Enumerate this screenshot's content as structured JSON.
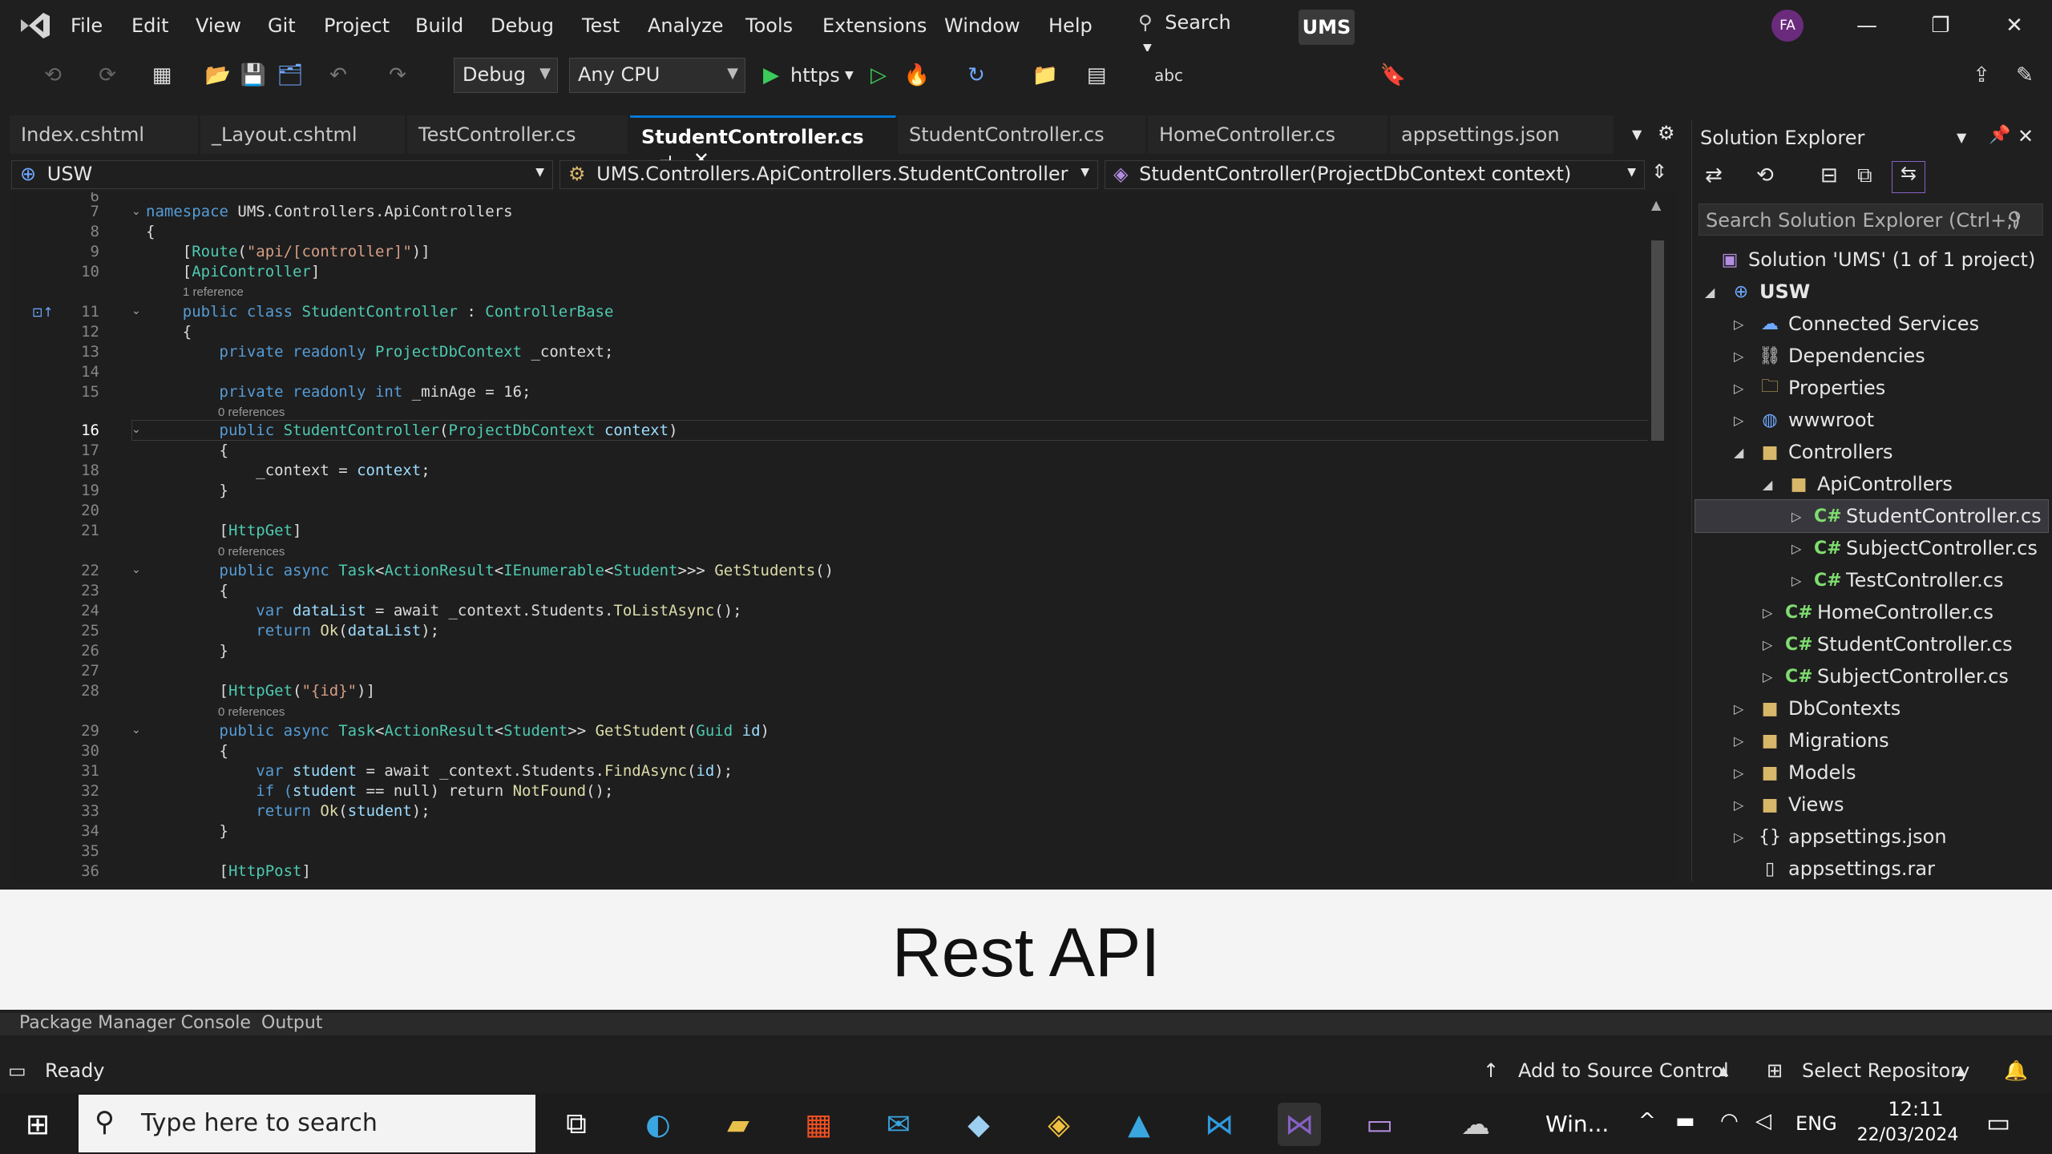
{
  "title_bar": {
    "menus": [
      "File",
      "Edit",
      "View",
      "Git",
      "Project",
      "Build",
      "Debug",
      "Test",
      "Analyze",
      "Tools",
      "Extensions",
      "Window",
      "Help"
    ],
    "search_label": "Search",
    "solution_name": "UMS",
    "avatar_initials": "FA",
    "minimize": "—",
    "restore": "❐",
    "close": "✕"
  },
  "toolbar": {
    "config": "Debug",
    "platform": "Any CPU",
    "run_profile": "https"
  },
  "tabs": [
    {
      "label": "Index.cshtml"
    },
    {
      "label": "_Layout.cshtml"
    },
    {
      "label": "TestController.cs"
    },
    {
      "label": "StudentController.cs"
    },
    {
      "label": "StudentController.cs"
    },
    {
      "label": "HomeController.cs"
    },
    {
      "label": "appsettings.json"
    }
  ],
  "navbar": {
    "project": "USW",
    "type": "UMS.Controllers.ApiControllers.StudentController",
    "member": "StudentController(ProjectDbContext context)"
  },
  "editor": {
    "line_numbers": [
      "6",
      "7",
      "8",
      "9",
      "10",
      "11",
      "12",
      "13",
      "14",
      "15",
      "16",
      "17",
      "18",
      "19",
      "20",
      "21",
      "22",
      "23",
      "24",
      "25",
      "26",
      "27",
      "28",
      "29",
      "30",
      "31",
      "32",
      "33",
      "34",
      "35",
      "36"
    ],
    "refs": {
      "one": "1 reference",
      "zero": "0 references"
    },
    "code": {
      "l7a": "namespace",
      "l7b": " UMS.Controllers.ApiControllers",
      "l8": "{",
      "l9a": "    [",
      "l9b": "Route",
      "l9c": "(",
      "l9d": "\"api/[controller]\"",
      "l9e": ")]",
      "l10a": "    [",
      "l10b": "ApiController",
      "l10c": "]",
      "l11a": "    public class ",
      "l11b": "StudentController",
      "l11c": " : ",
      "l11d": "ControllerBase",
      "l12": "    {",
      "l13a": "        private readonly ",
      "l13b": "ProjectDbContext",
      "l13c": " _context;",
      "l15a": "        private readonly int",
      "l15b": " _minAge = 16;",
      "l16a": "        public ",
      "l16b": "StudentController",
      "l16c": "(",
      "l16d": "ProjectDbContext",
      "l16e": " context",
      "l16f": ")",
      "l17": "        {",
      "l18a": "            _context = ",
      "l18b": "context",
      "l18c": ";",
      "l19": "        }",
      "l21a": "        [",
      "l21b": "HttpGet",
      "l21c": "]",
      "l22a": "        public async ",
      "l22b": "Task",
      "l22c": "<",
      "l22d": "ActionResult",
      "l22e": "<",
      "l22f": "IEnumerable",
      "l22g": "<",
      "l22h": "Student",
      "l22i": ">>> ",
      "l22j": "GetStudents",
      "l22k": "()",
      "l23": "        {",
      "l24a": "            var ",
      "l24b": "dataList",
      "l24c": " = await _context.",
      "l24d": "Students",
      "l24e": ".",
      "l24f": "ToListAsync",
      "l24g": "();",
      "l25a": "            return ",
      "l25b": "Ok",
      "l25c": "(",
      "l25d": "dataList",
      "l25e": ");",
      "l26": "        }",
      "l28a": "        [",
      "l28b": "HttpGet",
      "l28c": "(",
      "l28d": "\"{id}\"",
      "l28e": ")]",
      "l29a": "        public async ",
      "l29b": "Task",
      "l29c": "<",
      "l29d": "ActionResult",
      "l29e": "<",
      "l29f": "Student",
      "l29g": ">> ",
      "l29h": "GetStudent",
      "l29i": "(",
      "l29j": "Guid",
      "l29k": " id",
      "l29l": ")",
      "l30": "        {",
      "l31a": "            var ",
      "l31b": "student",
      "l31c": " = await _context.",
      "l31d": "Students",
      "l31e": ".",
      "l31f": "FindAsync",
      "l31g": "(",
      "l31h": "id",
      "l31i": ");",
      "l32a": "            if (",
      "l32b": "student",
      "l32c": " == null) return ",
      "l32d": "NotFound",
      "l32e": "();",
      "l33a": "            return ",
      "l33b": "Ok",
      "l33c": "(",
      "l33d": "student",
      "l33e": ");",
      "l34": "        }",
      "l36a": "        [",
      "l36b": "HttpPost",
      "l36c": "]"
    }
  },
  "solution_explorer": {
    "title": "Solution Explorer",
    "search_placeholder": "Search Solution Explorer (Ctrl+;)",
    "solution_label": "Solution 'UMS' (1 of 1 project)",
    "project": "USW",
    "items": [
      "Connected Services",
      "Dependencies",
      "Properties",
      "wwwroot",
      "Controllers",
      "ApiControllers",
      "StudentController.cs",
      "SubjectController.cs",
      "TestController.cs",
      "HomeController.cs",
      "StudentController.cs",
      "SubjectController.cs",
      "DbContexts",
      "Migrations",
      "Models",
      "Views",
      "appsettings.json",
      "appsettings.rar"
    ]
  },
  "banner": {
    "text": "Rest API"
  },
  "bottom_panel": {
    "tab1": "Package Manager Console",
    "tab2": "Output"
  },
  "statusbar": {
    "ready": "Ready",
    "source_control": "Add to Source Control",
    "repository": "Select Repository"
  },
  "taskbar": {
    "search_placeholder": "Type here to search",
    "weather": "Win...",
    "language": "ENG",
    "time": "12:11",
    "date": "22/03/2024"
  },
  "colors": {
    "accent": "#0078d4",
    "vs_purple": "#8661c5",
    "background": "#1f1f1f"
  }
}
